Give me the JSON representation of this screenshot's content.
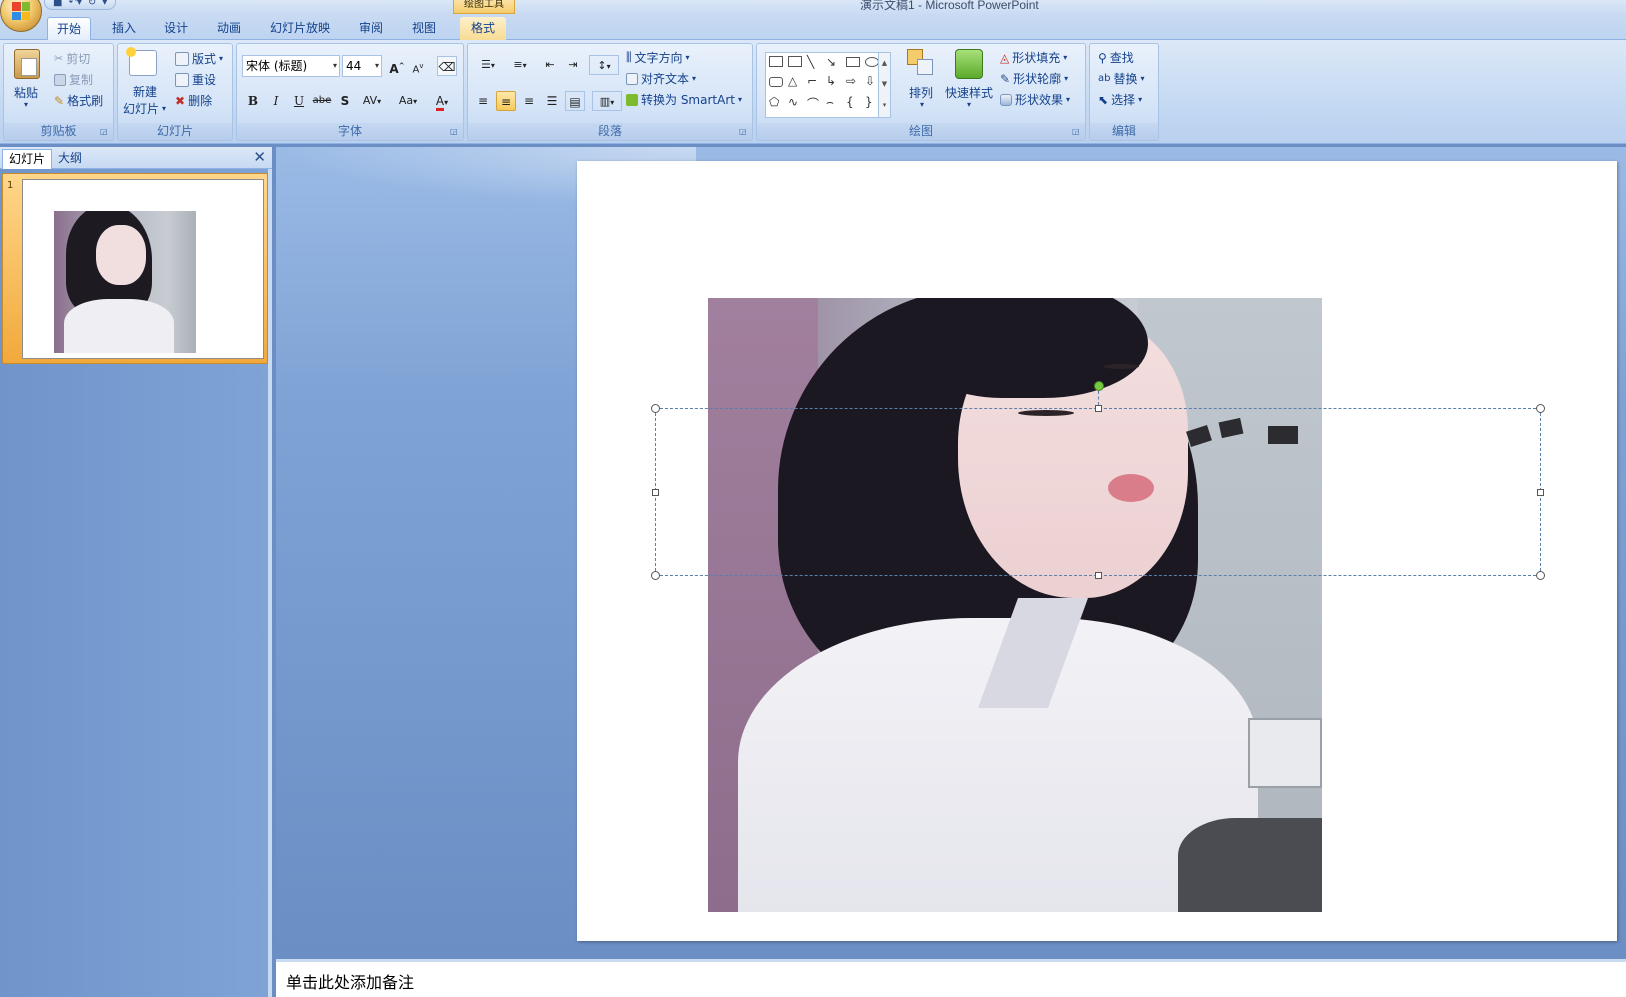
{
  "window": {
    "title": "演示文稿1 - Microsoft PowerPoint",
    "context_tab_group": "绘图工具"
  },
  "tabs": [
    "开始",
    "插入",
    "设计",
    "动画",
    "幻灯片放映",
    "审阅",
    "视图",
    "格式"
  ],
  "active_tab": "开始",
  "ribbon": {
    "clipboard": {
      "label": "剪贴板",
      "paste": "粘贴",
      "cut": "剪切",
      "copy": "复制",
      "format_painter": "格式刷"
    },
    "slides": {
      "label": "幻灯片",
      "new_slide_1": "新建",
      "new_slide_2": "幻灯片",
      "layout": "版式",
      "reset": "重设",
      "delete": "删除"
    },
    "font": {
      "label": "字体",
      "font_name": "宋体 (标题)",
      "font_size": "44",
      "bold": "B",
      "italic": "I",
      "underline": "U",
      "strike": "abe",
      "shadow": "S",
      "spacing": "AV",
      "case": "Aa",
      "color": "A",
      "grow": "A",
      "shrink": "A"
    },
    "paragraph": {
      "label": "段落",
      "text_direction": "文字方向",
      "align_text": "对齐文本",
      "smartart": "转换为 SmartArt"
    },
    "drawing": {
      "label": "绘图",
      "arrange": "排列",
      "quick_styles": "快速样式",
      "shape_fill": "形状填充",
      "shape_outline": "形状轮廓",
      "shape_effects": "形状效果"
    },
    "editing": {
      "label": "编辑",
      "find": "查找",
      "replace": "替换",
      "select": "选择"
    }
  },
  "left_pane": {
    "tabs": [
      "幻灯片",
      "大纲"
    ],
    "active_tab": "幻灯片",
    "slide_numbers": [
      "1"
    ]
  },
  "notes": {
    "placeholder": "单击此处添加备注"
  },
  "colors": {
    "accent": "#15428b",
    "ribbon_bg": "#c5daf3",
    "selection_orange": "#f2a93b",
    "rotation_handle": "#79c843"
  }
}
